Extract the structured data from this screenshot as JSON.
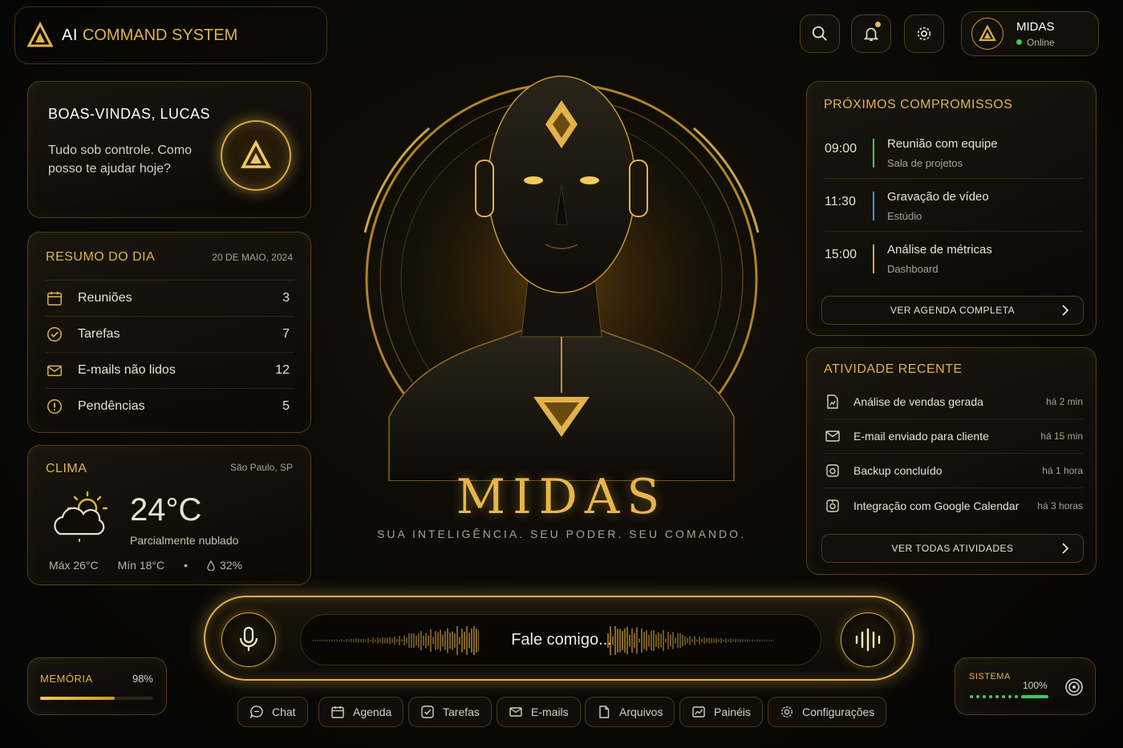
{
  "header": {
    "brand_ai": "AI",
    "brand_rest": "COMMAND SYSTEM",
    "icons": [
      "search-icon",
      "bell-icon",
      "gear-icon"
    ],
    "user": {
      "name": "MIDAS",
      "status": "Online"
    }
  },
  "welcome": {
    "title": "BOAS-VINDAS, LUCAS",
    "message": "Tudo sob controle. Como posso te ajudar hoje?"
  },
  "summary": {
    "title": "RESUMO DO DIA",
    "date": "20 DE MAIO, 2024",
    "items": [
      {
        "label": "Reuniões",
        "value": "3",
        "icon": "calendar-icon"
      },
      {
        "label": "Tarefas",
        "value": "7",
        "icon": "check-circle-icon"
      },
      {
        "label": "E-mails não lidos",
        "value": "12",
        "icon": "mail-icon"
      },
      {
        "label": "Pendências",
        "value": "5",
        "icon": "alert-icon"
      }
    ]
  },
  "weather": {
    "title": "CLIMA",
    "location": "São Paulo, SP",
    "temp": "24°C",
    "description": "Parcialmente nublado",
    "max": "Máx 26°C",
    "min": "Mín 18°C",
    "sep": "•",
    "humidity": "32%"
  },
  "memory": {
    "label": "MEMÓRIA",
    "value": "98%",
    "fill_fraction": 0.66
  },
  "center": {
    "title": "MIDAS",
    "subtitle": "SUA INTELIGÊNCIA. SEU PODER. SEU COMANDO."
  },
  "agenda": {
    "title": "PRÓXIMOS COMPROMISSOS",
    "items": [
      {
        "time": "09:00",
        "title": "Reunião com equipe",
        "sub": "Sala de projetos",
        "color": "#3ccb5a"
      },
      {
        "time": "11:30",
        "title": "Gravação de vídeo",
        "sub": "Estúdio",
        "color": "#4a8fd9"
      },
      {
        "time": "15:00",
        "title": "Análise de métricas",
        "sub": "Dashboard",
        "color": "#e0a23a"
      }
    ],
    "button": "VER AGENDA COMPLETA"
  },
  "activity": {
    "title": "ATIVIDADE RECENTE",
    "items": [
      {
        "text": "Análise de vendas gerada",
        "when": "há 2 min",
        "icon": "file-chart-icon"
      },
      {
        "text": "E-mail enviado para cliente",
        "when": "há 15 min",
        "icon": "mail-icon"
      },
      {
        "text": "Backup concluído",
        "when": "há 1 hora",
        "icon": "backup-icon"
      },
      {
        "text": "Integração com Google Calendar",
        "when": "há 3 horas",
        "icon": "integration-icon"
      }
    ],
    "button": "VER TODAS ATIVIDADES"
  },
  "voice": {
    "placeholder": "Fale comigo..."
  },
  "dock": [
    {
      "label": "Chat",
      "icon": "chat-icon"
    },
    {
      "label": "Agenda",
      "icon": "calendar-icon"
    },
    {
      "label": "Tarefas",
      "icon": "check-square-icon"
    },
    {
      "label": "E-mails",
      "icon": "mail-icon"
    },
    {
      "label": "Arquivos",
      "icon": "file-icon"
    },
    {
      "label": "Painéis",
      "icon": "chart-icon"
    },
    {
      "label": "Configurações",
      "icon": "gear-icon"
    }
  ],
  "system": {
    "label": "SISTEMA",
    "value": "100%"
  },
  "colors": {
    "accent": "#e0b24a",
    "online": "#3ccb5a"
  }
}
